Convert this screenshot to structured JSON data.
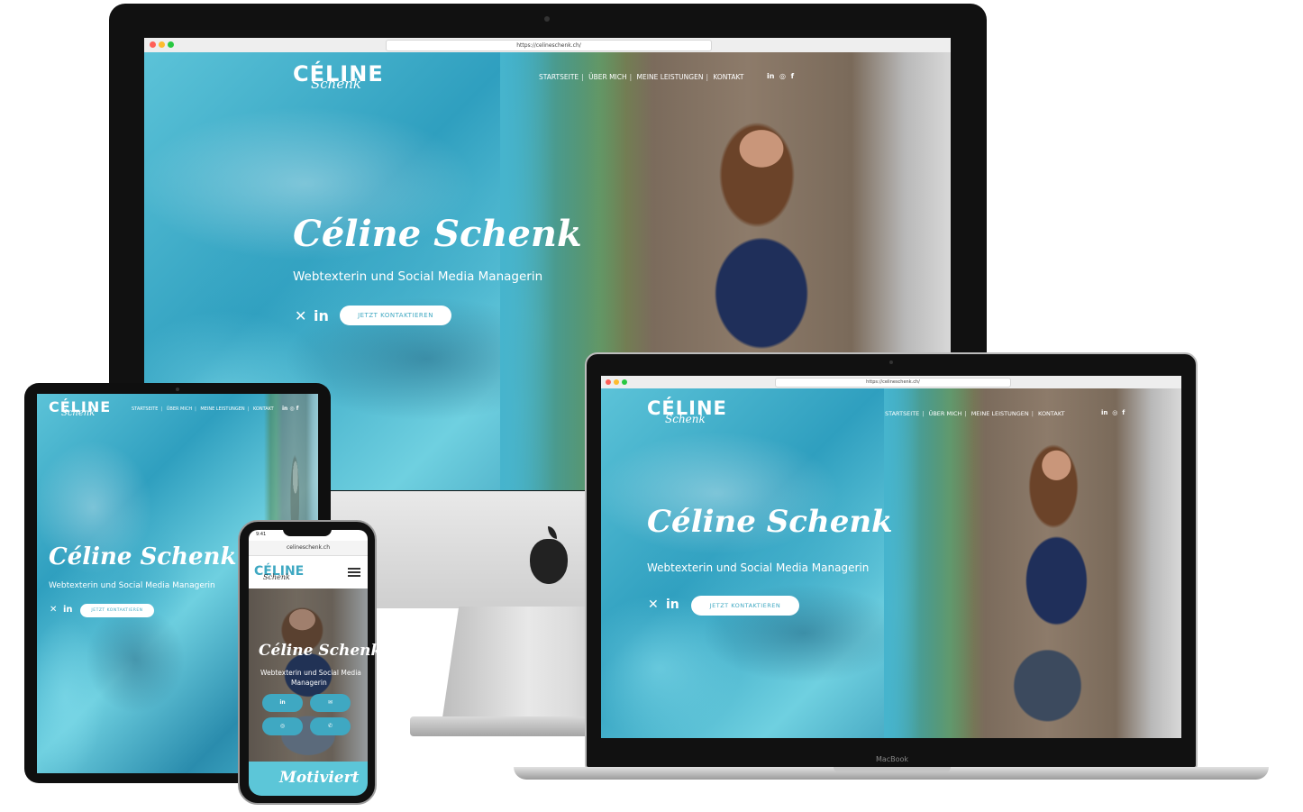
{
  "site": {
    "url": "https://celineschenk.ch/",
    "url_mobile": "celineschenk.ch",
    "logo_main": "CÉLINE",
    "logo_script": "Schenk",
    "nav": [
      "STARTSEITE",
      "ÜBER MICH",
      "MEINE LEISTUNGEN",
      "KONTAKT"
    ],
    "social_icons": [
      "in",
      "◎",
      "f"
    ],
    "hero_title": "Céline Schenk",
    "hero_subtitle": "Webtexterin und Social Media Managerin",
    "hero_subtitle_mobile_1": "Webtexterin und Social Media",
    "hero_subtitle_mobile_2": "Managerin",
    "cta_label": "JETZT KONTAKTIEREN",
    "hero_social": [
      "✕",
      "in"
    ],
    "mobile_bottom_script": "Motiviert",
    "mobile_time": "9:41"
  },
  "devices": {
    "laptop_label": "MacBook"
  },
  "colors": {
    "accent": "#3fa8c2",
    "mobile_header": "#ffffff",
    "mobile_footer": "#5cc6d8"
  }
}
